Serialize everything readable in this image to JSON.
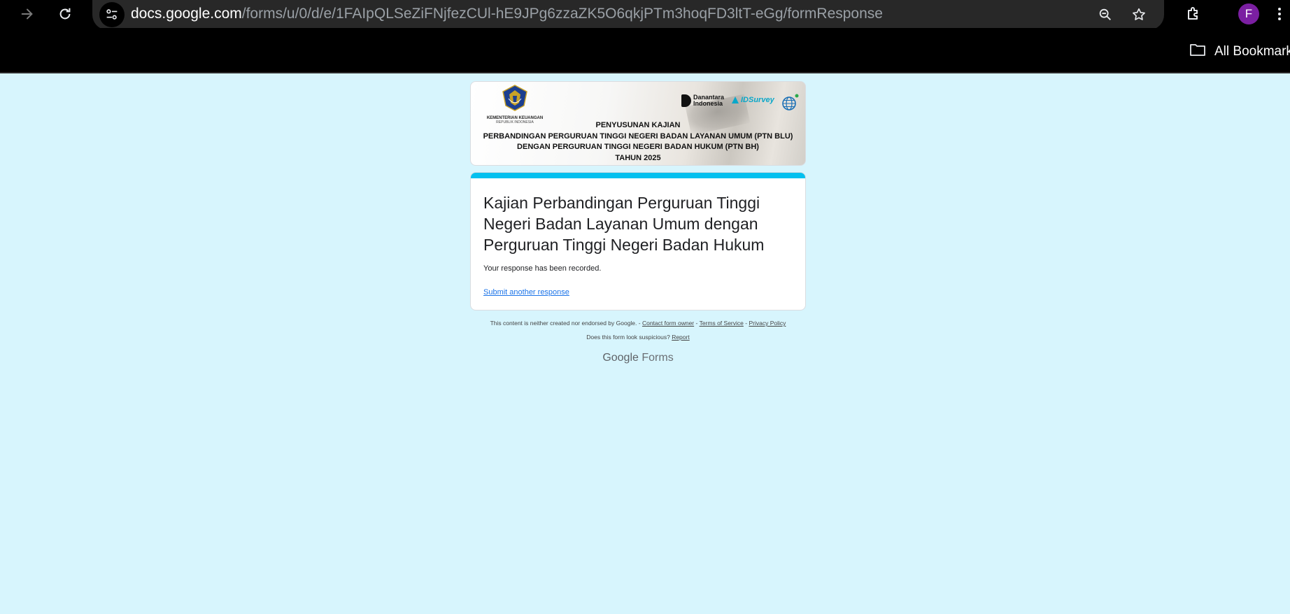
{
  "browser": {
    "url_host": "docs.google.com",
    "url_path": "/forms/u/0/d/e/1FAIpQLSeZiFNjfezCUl-hE9JPg6zzaZK5O6qkjPTm3hoqFD3ltT-eGg/formResponse",
    "profile_initial": "F",
    "profile_color": "#7b1fa2",
    "all_bookmarks_label": "All Bookmarks"
  },
  "banner": {
    "ministry_name": "KEMENTERIAN KEUANGAN",
    "ministry_sub": "REPUBLIK INDONESIA",
    "partner1_line1": "Danantara",
    "partner1_line2": "Indonesia",
    "partner2": "IDSurvey",
    "lines": [
      "PENYUSUNAN KAJIAN",
      "PERBANDINGAN PERGURUAN TINGGI NEGERI BADAN LAYANAN UMUM (PTN BLU)",
      "DENGAN PERGURUAN TINGGI NEGERI BADAN HUKUM (PTN BH)",
      "TAHUN 2025"
    ]
  },
  "form": {
    "accent_color": "#03c0ef",
    "title": "Kajian Perbandingan Perguruan Tinggi Negeri Badan Layanan Umum dengan Perguruan Tinggi Negeri Badan Hukum",
    "confirmation": "Your response has been recorded.",
    "submit_another": "Submit another response"
  },
  "footer": {
    "disclaimer": "This content is neither created nor endorsed by Google. -",
    "contact": "Contact form owner",
    "sep1": "-",
    "terms": "Terms of Service",
    "sep2": "-",
    "privacy": "Privacy Policy",
    "suspicious": "Does this form look suspicious?",
    "report": "Report",
    "brand_google": "Google",
    "brand_forms": "Forms"
  },
  "colors": {
    "page_background": "#d7f5fd",
    "link": "#1a73e8"
  }
}
